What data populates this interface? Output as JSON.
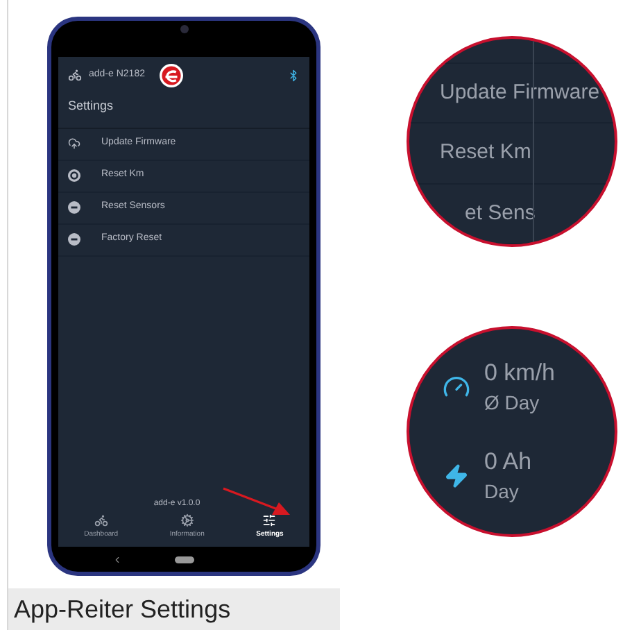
{
  "phone": {
    "device": "add-e N2182",
    "title": "Settings",
    "menu": [
      {
        "label": "Update Firmware",
        "kind": "cloud"
      },
      {
        "label": "Reset Km",
        "kind": "reset"
      },
      {
        "label": "Reset Sensors",
        "kind": "minus"
      },
      {
        "label": "Factory Reset",
        "kind": "minus"
      }
    ],
    "version": "add-e v1.0.0",
    "tabs": [
      {
        "label": "Dashboard",
        "kind": "bike",
        "selected": false
      },
      {
        "label": "Information",
        "kind": "gear",
        "selected": false
      },
      {
        "label": "Settings",
        "kind": "sliders",
        "selected": true
      }
    ]
  },
  "zoom_circles": [
    {
      "kind": "menu",
      "items": [
        "Update Firmware",
        "Reset Km",
        "et Sens"
      ]
    },
    {
      "kind": "stats",
      "items": [
        {
          "kind": "speed",
          "value": "0 km/h",
          "label": "Ø Day"
        },
        {
          "kind": "charge",
          "value": "0 Ah",
          "label": "Day"
        }
      ]
    }
  ],
  "caption": "App-Reiter Settings"
}
